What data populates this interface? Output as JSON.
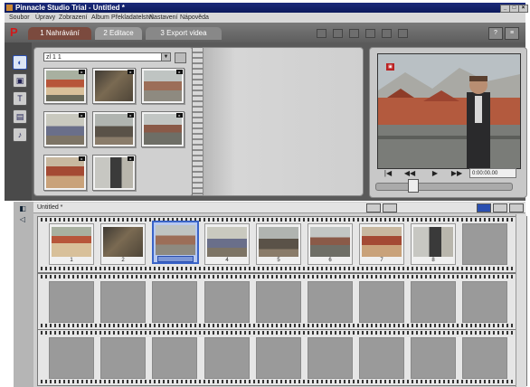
{
  "window": {
    "title": "Pinnacle Studio Trial - Untitled *"
  },
  "menu": [
    "Soubor",
    "Úpravy",
    "Zobrazení",
    "Album",
    "Překladatelství",
    "Nastavení",
    "Nápověda"
  ],
  "tabs": [
    "1 Nahrávání",
    "2 Editace",
    "3 Export videa"
  ],
  "album": {
    "dropdown_value": "zl 1 1"
  },
  "player": {
    "timecode": "0:00:00.00"
  },
  "movie": {
    "title": "Untitled *",
    "clip_numbers": [
      "1",
      "2",
      "3",
      "4",
      "5",
      "6",
      "7",
      "8"
    ]
  },
  "colors": {
    "selection": "#3a64c8",
    "active_tab": "#7b4a3e",
    "logo": "#d01a1a"
  }
}
